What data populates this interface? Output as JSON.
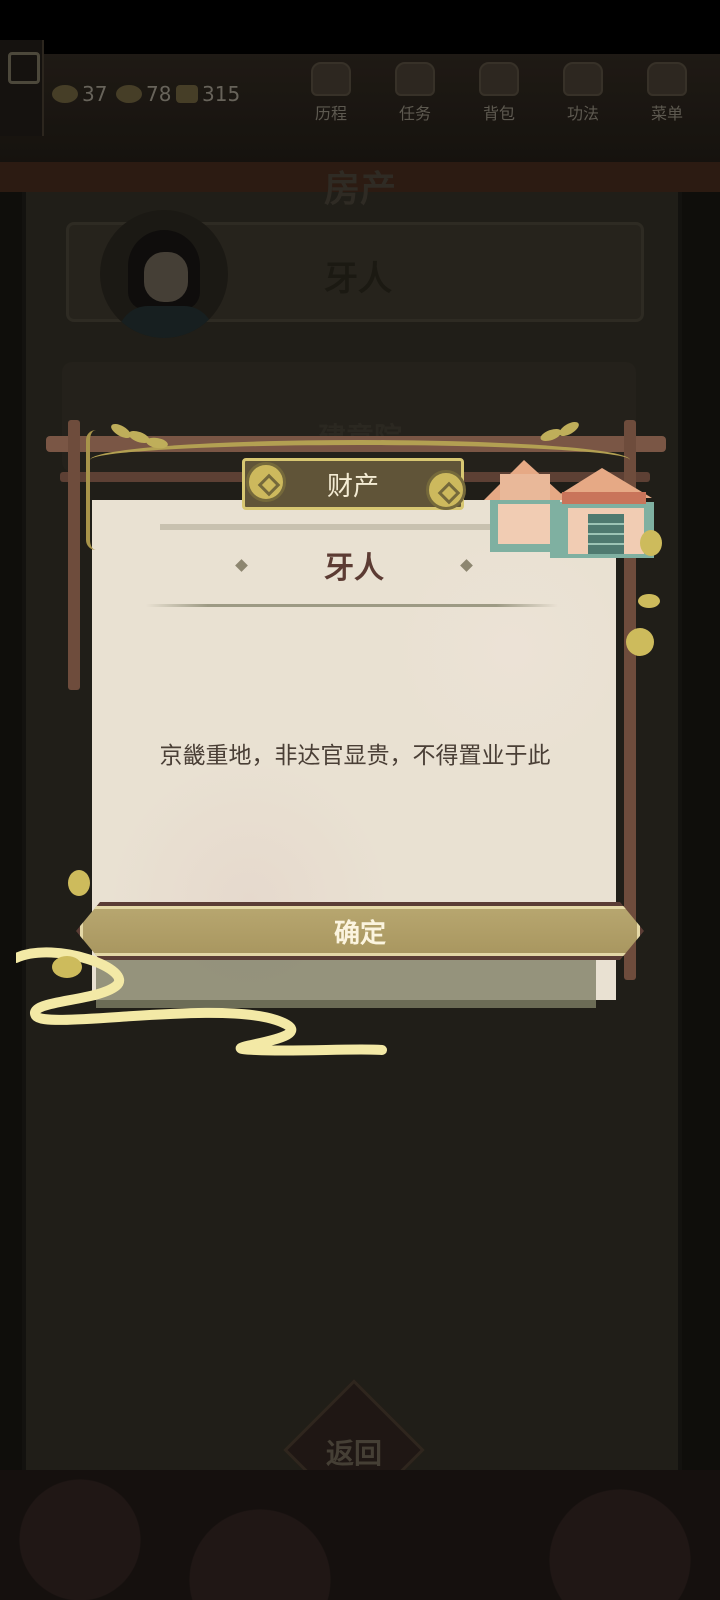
{
  "hud": {
    "resources": [
      {
        "icon": "gold-ingot-icon",
        "value": "37"
      },
      {
        "icon": "silver-ingot-icon",
        "value": "78"
      },
      {
        "icon": "copper-coin-icon",
        "value": "315"
      }
    ],
    "nav": [
      {
        "label": "历程",
        "icon": "journey-icon"
      },
      {
        "label": "任务",
        "icon": "task-icon"
      },
      {
        "label": "背包",
        "icon": "bag-icon"
      },
      {
        "label": "功法",
        "icon": "skill-book-icon"
      },
      {
        "label": "菜单",
        "icon": "fan-menu-icon"
      }
    ]
  },
  "page": {
    "title": "房产",
    "npc_name": "牙人",
    "list_item_partial": "建意院",
    "back_label": "返回"
  },
  "dialog": {
    "header": "财产",
    "title": "牙人",
    "message": "京畿重地，非达官显贵，不得置业于此",
    "confirm_label": "确定"
  },
  "colors": {
    "paper": "#e9e1d2",
    "header_bg": "#605438",
    "header_border": "#d8c772",
    "button_gold": "#b8a770",
    "title_brown": "#5c3b33"
  }
}
